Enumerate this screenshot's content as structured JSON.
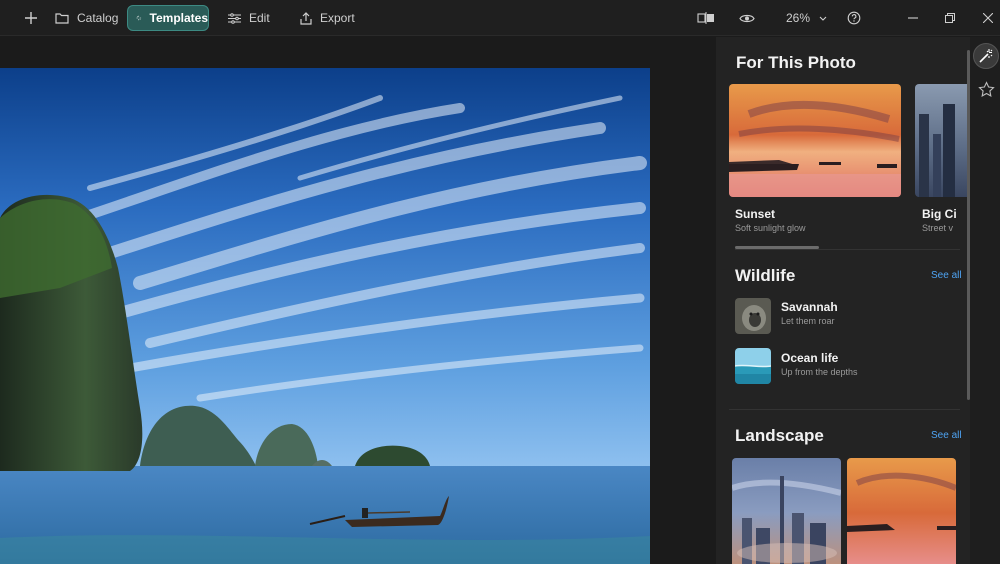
{
  "toolbar": {
    "catalog_label": "Catalog",
    "templates_label": "Templates",
    "edit_label": "Edit",
    "export_label": "Export",
    "zoom_level": "26%"
  },
  "panel": {
    "for_this_photo": {
      "title": "For This Photo",
      "cards": [
        {
          "title": "Sunset",
          "subtitle": "Soft sunlight glow"
        },
        {
          "title": "Big Ci",
          "subtitle": "Street v"
        }
      ]
    },
    "wildlife": {
      "title": "Wildlife",
      "see_all": "See all",
      "items": [
        {
          "title": "Savannah",
          "subtitle": "Let them roar"
        },
        {
          "title": "Ocean life",
          "subtitle": "Up from the depths"
        }
      ]
    },
    "landscape": {
      "title": "Landscape",
      "see_all": "See all"
    }
  },
  "colors": {
    "accent_teal": "#2a5b57",
    "link_blue": "#4ea3f2",
    "panel_bg": "#232323"
  }
}
